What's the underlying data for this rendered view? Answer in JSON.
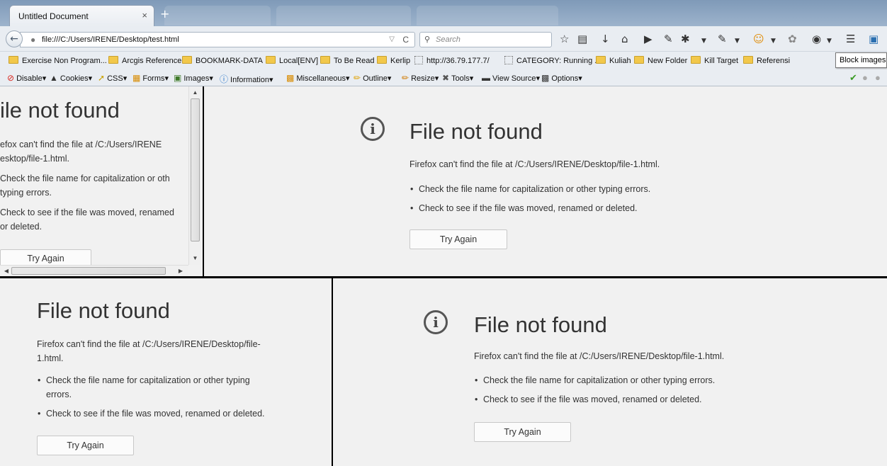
{
  "window": {
    "tab_title": "Untitled Document",
    "tab_close": "×",
    "new_tab": "+"
  },
  "navbar": {
    "url": "file:///C:/Users/IRENE/Desktop/test.html",
    "search_placeholder": "Search"
  },
  "bookmarks": [
    {
      "label": "Exercise Non Program...",
      "kind": "folder"
    },
    {
      "label": "Arcgis Reference",
      "kind": "folder"
    },
    {
      "label": "BOOKMARK-DATA",
      "kind": "folder"
    },
    {
      "label": "Local[ENV]",
      "kind": "folder"
    },
    {
      "label": "To Be Read",
      "kind": "folder"
    },
    {
      "label": "Kerlip",
      "kind": "folder"
    },
    {
      "label": "http://36.79.177.7/",
      "kind": "page"
    },
    {
      "label": "CATEGORY: Running ...",
      "kind": "page"
    },
    {
      "label": "Kuliah",
      "kind": "folder"
    },
    {
      "label": "New Folder",
      "kind": "folder"
    },
    {
      "label": "Kill Target",
      "kind": "folder"
    },
    {
      "label": "Referensi",
      "kind": "folder"
    }
  ],
  "tooltip": "Block images",
  "devbar": [
    {
      "label": "Disable",
      "icon": "disable-icon"
    },
    {
      "label": "Cookies",
      "icon": "cookies-icon"
    },
    {
      "label": "CSS",
      "icon": "css-icon"
    },
    {
      "label": "Forms",
      "icon": "forms-icon"
    },
    {
      "label": "Images",
      "icon": "images-icon"
    },
    {
      "label": "Information",
      "icon": "information-icon"
    },
    {
      "label": "Miscellaneous",
      "icon": "miscellaneous-icon"
    },
    {
      "label": "Outline",
      "icon": "outline-icon"
    },
    {
      "label": "Resize",
      "icon": "resize-icon"
    },
    {
      "label": "Tools",
      "icon": "tools-icon"
    },
    {
      "label": "View Source",
      "icon": "view-source-icon"
    },
    {
      "label": "Options",
      "icon": "options-icon"
    }
  ],
  "frames": {
    "top_left": {
      "title": "ile not found",
      "desc_line1": "efox can't find the file at /C:/Users/IRENE",
      "desc_line2": "esktop/file-1.html.",
      "b1_line1": "Check the file name for capitalization or oth",
      "b1_line2": "typing errors.",
      "b2_line1": "Check to see if the file was moved, renamed",
      "b2_line2": "or deleted.",
      "button": "Try Again"
    },
    "top_right": {
      "title": "File not found",
      "desc": "Firefox can't find the file at /C:/Users/IRENE/Desktop/file-1.html.",
      "bullet1": "Check the file name for capitalization or other typing errors.",
      "bullet2": "Check to see if the file was moved, renamed or deleted.",
      "button": "Try Again"
    },
    "bottom_left": {
      "title": "File not found",
      "desc_line1": "Firefox can't find the file at /C:/Users/IRENE/Desktop/file-",
      "desc_line2": "1.html.",
      "b1_line1": "Check the file name for capitalization or other typing",
      "b1_line2": "errors.",
      "bullet2": "Check to see if the file was moved, renamed or deleted.",
      "button": "Try Again"
    },
    "bottom_right": {
      "title": "File not found",
      "desc": "Firefox can't find the file at /C:/Users/IRENE/Desktop/file-1.html.",
      "bullet1": "Check the file name for capitalization or other typing errors.",
      "bullet2": "Check to see if the file was moved, renamed or deleted.",
      "button": "Try Again"
    }
  },
  "colors": {
    "page_bg": "#f1f1f1",
    "text": "#333333",
    "divider": "#000000"
  }
}
